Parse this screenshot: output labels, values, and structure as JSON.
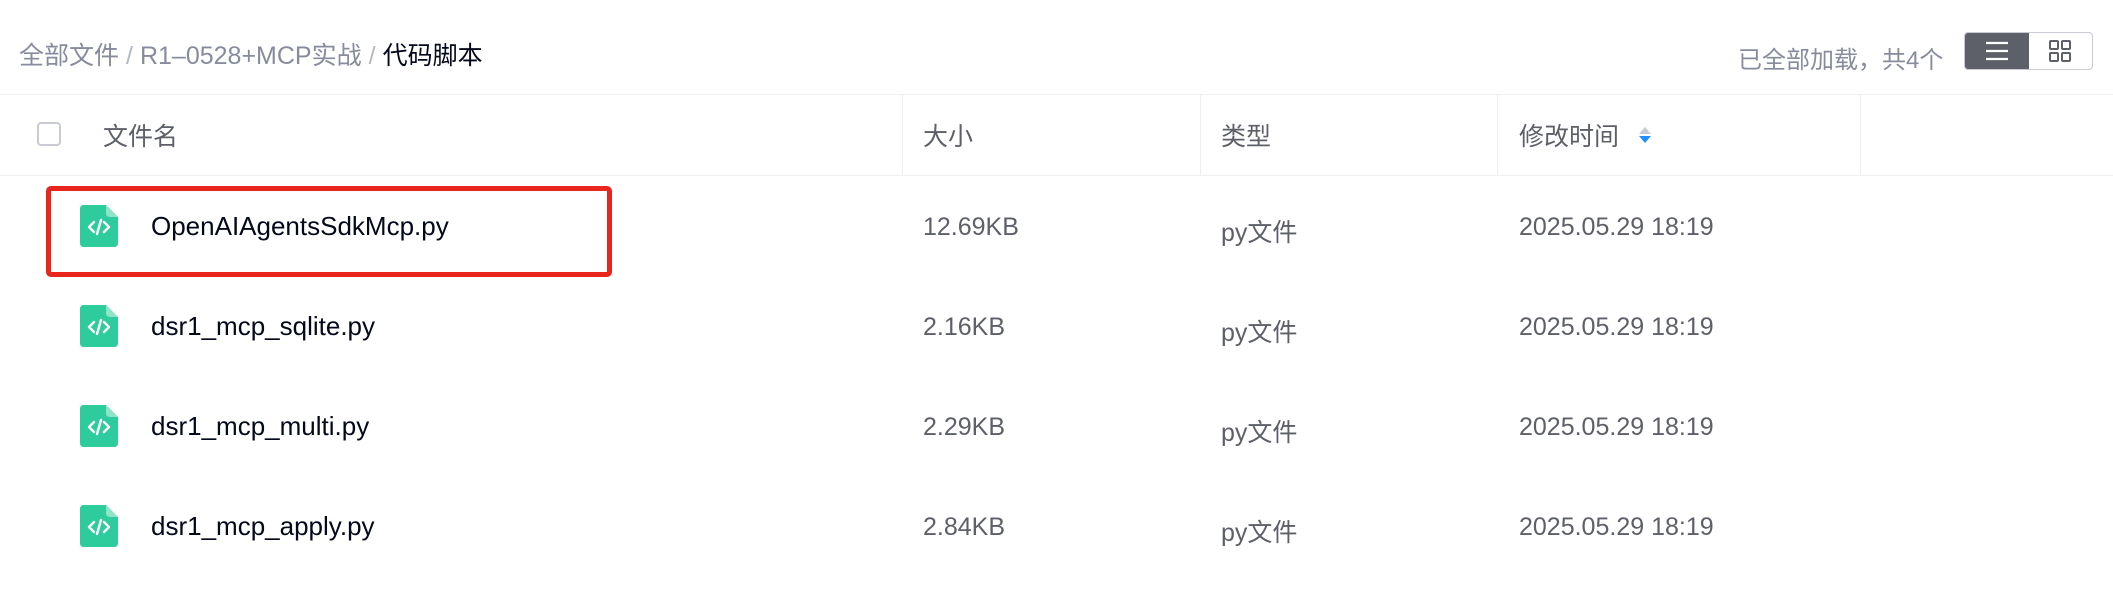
{
  "breadcrumb": {
    "root": "全部文件",
    "folder": "R1–0528+MCP实战",
    "current": "代码脚本",
    "separator": "/"
  },
  "status": "已全部加载，共4个",
  "view_switch": {
    "active": "list",
    "list_icon": "list-icon",
    "grid_icon": "grid-icon"
  },
  "columns": {
    "name": "文件名",
    "size": "大小",
    "type": "类型",
    "modified": "修改时间"
  },
  "sort": {
    "column": "modified",
    "direction": "descending"
  },
  "files": [
    {
      "name": "OpenAIAgentsSdkMcp.py",
      "size": "12.69KB",
      "type": "py文件",
      "modified": "2025.05.29 18:19",
      "icon": "code-file-icon"
    },
    {
      "name": "dsr1_mcp_sqlite.py",
      "size": "2.16KB",
      "type": "py文件",
      "modified": "2025.05.29 18:19",
      "icon": "code-file-icon"
    },
    {
      "name": "dsr1_mcp_multi.py",
      "size": "2.29KB",
      "type": "py文件",
      "modified": "2025.05.29 18:19",
      "icon": "code-file-icon"
    },
    {
      "name": "dsr1_mcp_apply.py",
      "size": "2.84KB",
      "type": "py文件",
      "modified": "2025.05.29 18:19",
      "icon": "code-file-icon"
    }
  ],
  "colors": {
    "accent": "#1e90ff",
    "file_icon": "#2ecb9c",
    "highlight_box": "#e8261d",
    "view_active": "#5d6068"
  }
}
